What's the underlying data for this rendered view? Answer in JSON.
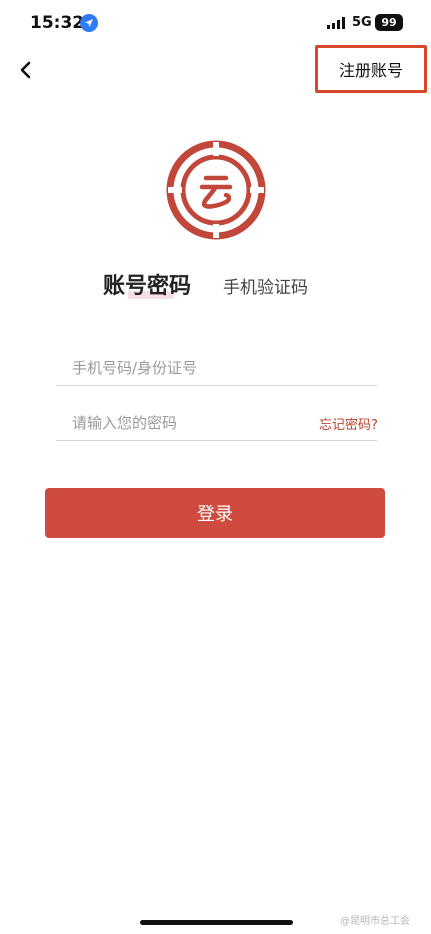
{
  "status_bar": {
    "time": "15:32",
    "network": "5G",
    "battery": "99",
    "location_icon": "location-arrow-icon",
    "signal_icon": "signal-bars-icon"
  },
  "nav": {
    "back_icon": "chevron-left-icon",
    "register_label": "注册账号",
    "highlight_color": "#d9472b"
  },
  "logo": {
    "icon": "circular-emblem-logo",
    "color": "#c0473a"
  },
  "tabs": {
    "account_password": "账号密码",
    "sms_code": "手机验证码"
  },
  "form": {
    "phone_placeholder": "手机号码/身份证号",
    "phone_value": "",
    "password_placeholder": "请输入您的密码",
    "password_value": "",
    "forgot_label": "忘记密码?",
    "login_label": "登录",
    "accent_color": "#d04b3f"
  },
  "watermark": {
    "text": "@昆明市总工会"
  }
}
